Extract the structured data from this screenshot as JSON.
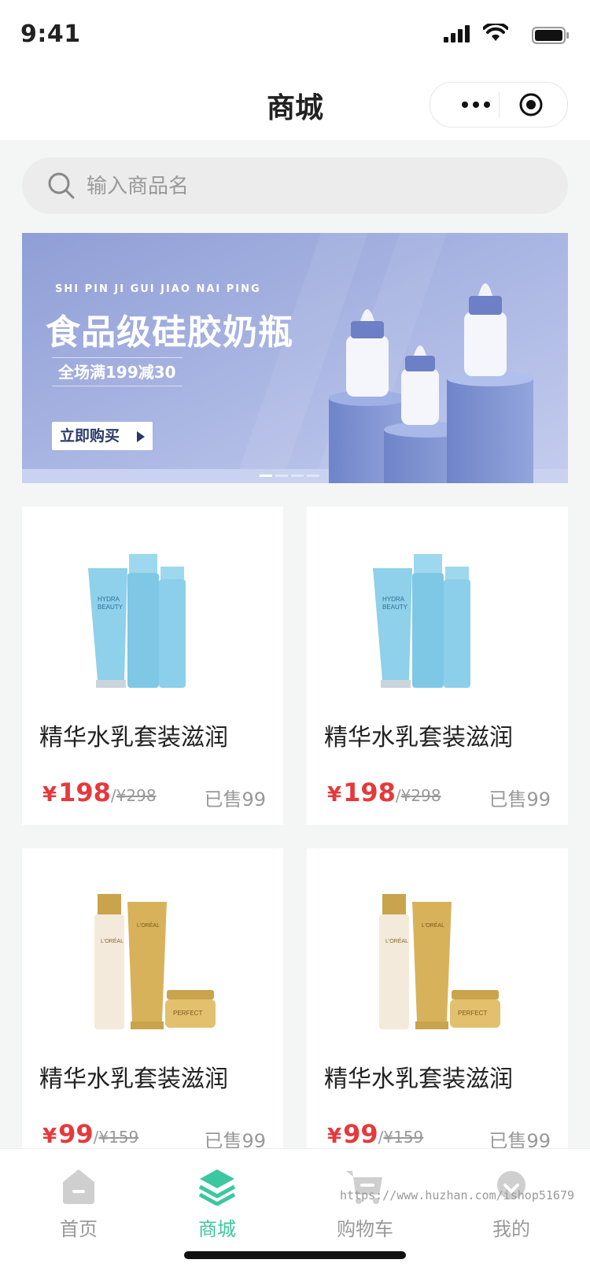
{
  "status_bar": {
    "time": "9:41"
  },
  "nav": {
    "title": "商城"
  },
  "search": {
    "placeholder": "输入商品名",
    "value": ""
  },
  "banner": {
    "subtitle_en": "SHI PIN JI GUI JIAO NAI PING",
    "title": "食品级硅胶奶瓶",
    "promo": "全场满199减30",
    "button": "立即购买",
    "slide_count": 4,
    "active_slide": 1,
    "colors": {
      "background": "#a9b6e0",
      "button_text": "#2b3a6a"
    }
  },
  "products": [
    {
      "name": "精华水乳套装滋润",
      "currency": "¥",
      "price": "198",
      "original_price": "¥298",
      "sold": "已售99",
      "image": "blue-skincare-set"
    },
    {
      "name": "精华水乳套装滋润",
      "currency": "¥",
      "price": "198",
      "original_price": "¥298",
      "sold": "已售99",
      "image": "blue-skincare-set"
    },
    {
      "name": "精华水乳套装滋润",
      "currency": "¥",
      "price": "99",
      "original_price": "¥159",
      "sold": "已售99",
      "image": "gold-skincare-set"
    },
    {
      "name": "精华水乳套装滋润",
      "currency": "¥",
      "price": "99",
      "original_price": "¥159",
      "sold": "已售99",
      "image": "gold-skincare-set"
    }
  ],
  "tabbar": {
    "items": [
      {
        "label": "首页",
        "icon": "home-icon",
        "active": false
      },
      {
        "label": "商城",
        "icon": "layers-icon",
        "active": true
      },
      {
        "label": "购物车",
        "icon": "cart-icon",
        "active": false
      },
      {
        "label": "我的",
        "icon": "profile-icon",
        "active": false
      }
    ],
    "watermark": "https://www.huzhan.com/ishop51679"
  },
  "colors": {
    "accent": "#3cc7a0",
    "price": "#e6393c",
    "muted": "#999999",
    "page_bg": "#f4f6f6"
  }
}
